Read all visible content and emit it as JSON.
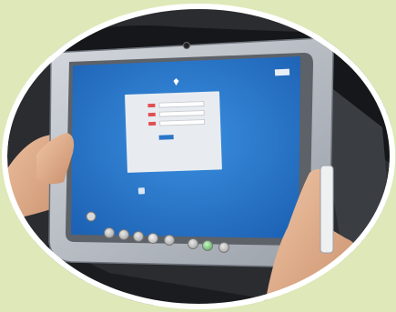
{
  "screen": {
    "app_title": "",
    "close_label": "",
    "login_button_label": "",
    "note_text": "",
    "brand_text": "",
    "form_rows": [
      {
        "label": ""
      },
      {
        "label": ""
      },
      {
        "label": ""
      }
    ]
  },
  "colors": {
    "background": "#dfe8b8",
    "screen_blue": "#2f7fd0",
    "tablet_frame": "#b9bec6",
    "skin": "#e4b391"
  },
  "icons": [
    "camera-icon",
    "windows-logo-icon",
    "power-icon"
  ]
}
